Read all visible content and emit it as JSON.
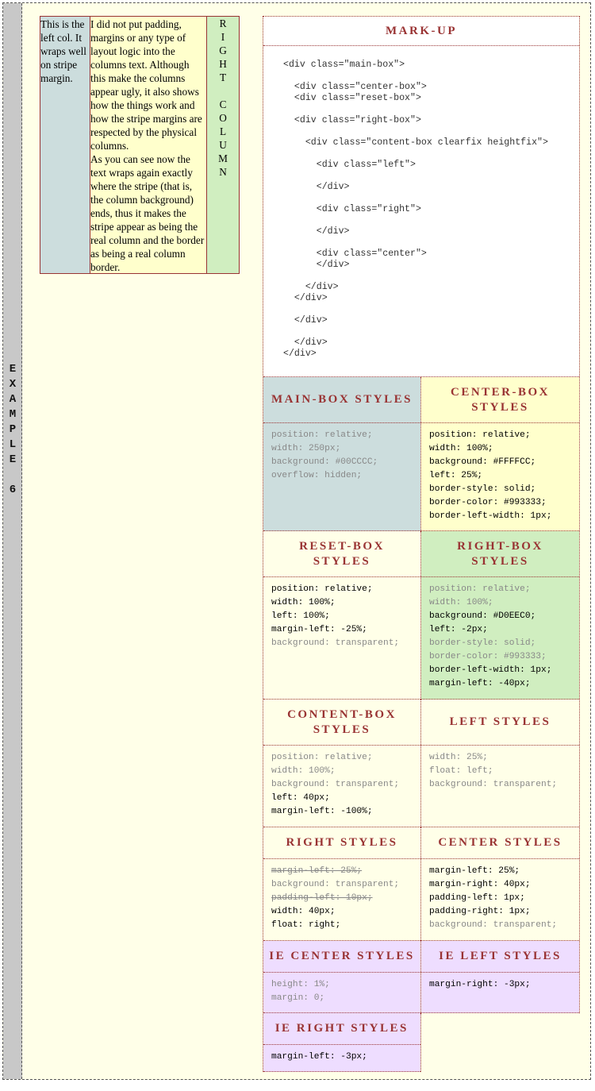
{
  "sidebar": {
    "title": "E\nX\nA\nM\nP\nL\nE\n\n6"
  },
  "demo": {
    "left_text": "This is the left col. It wraps well on stripe margin.",
    "center_text_1": "I did not put padding, margins or any type of layout logic into the columns text. Although this make the columns appear ugly, it also shows how the things work and how the stripe margins are respected by the physical columns.",
    "center_text_2": "As you can see now the text wraps again exactly where the stripe (that is, the column background) ends, thus it makes the stripe appear as being the real column and the border as being a real column border.",
    "right_text": "R\nI\nG\nH\nT\n\nC\nO\nL\nU\nM\nN"
  },
  "markup": {
    "title": "MARK-UP",
    "code": "<div class=\"main-box\">\n\n  <div class=\"center-box\">\n  <div class=\"reset-box\">\n\n  <div class=\"right-box\">\n\n    <div class=\"content-box clearfix heightfix\">\n\n      <div class=\"left\">\n\n      </div>\n\n      <div class=\"right\">\n\n      </div>\n\n      <div class=\"center\">\n      </div>\n\n    </div>\n  </div>\n\n  </div>\n\n  </div>\n</div>"
  },
  "colors": {
    "accent": "#993333",
    "main_box": "#00CCCC",
    "main_box_shown": "#CCDDDD",
    "center_box": "#FFFFCC",
    "right_box": "#D0EEC0",
    "ie": "#EEDDFF",
    "sidebar": "#C8C8C8",
    "page": "#FFFFE8"
  },
  "styles": [
    {
      "left": {
        "title": "MAIN-BOX STYLES",
        "lines": [
          {
            "text": "position: relative;",
            "state": "off"
          },
          {
            "text": "width: 250px;",
            "state": "off"
          },
          {
            "text": "background: #00CCCC;",
            "state": "off"
          },
          {
            "text": "overflow: hidden;",
            "state": "off"
          }
        ]
      },
      "right": {
        "title": "CENTER-BOX STYLES",
        "lines": [
          {
            "text": "position: relative;",
            "state": "on"
          },
          {
            "text": "width: 100%;",
            "state": "on"
          },
          {
            "text": "background: #FFFFCC;",
            "state": "on"
          },
          {
            "text": "left: 25%;",
            "state": "on"
          },
          {
            "text": "border-style: solid;",
            "state": "on"
          },
          {
            "text": "border-color: #993333;",
            "state": "on"
          },
          {
            "text": "border-left-width: 1px;",
            "state": "on"
          }
        ]
      }
    },
    {
      "left": {
        "title": "RESET-BOX STYLES",
        "lines": [
          {
            "text": "position: relative;",
            "state": "on"
          },
          {
            "text": "width: 100%;",
            "state": "on"
          },
          {
            "text": "left: 100%;",
            "state": "on"
          },
          {
            "text": "margin-left: -25%;",
            "state": "on"
          },
          {
            "text": "background: transparent;",
            "state": "off"
          }
        ]
      },
      "right": {
        "title": "RIGHT-BOX STYLES",
        "lines": [
          {
            "text": "position: relative;",
            "state": "off"
          },
          {
            "text": "width: 100%;",
            "state": "off"
          },
          {
            "text": "background: #D0EEC0;",
            "state": "on"
          },
          {
            "text": "left: -2px;",
            "state": "on"
          },
          {
            "text": "border-style: solid;",
            "state": "off"
          },
          {
            "text": "border-color: #993333;",
            "state": "off"
          },
          {
            "text": "border-left-width: 1px;",
            "state": "on"
          },
          {
            "text": "margin-left: -40px;",
            "state": "on"
          }
        ]
      }
    },
    {
      "left": {
        "title": "CONTENT-BOX STYLES",
        "lines": [
          {
            "text": "position: relative;",
            "state": "off"
          },
          {
            "text": "width: 100%;",
            "state": "off"
          },
          {
            "text": "background: transparent;",
            "state": "off"
          },
          {
            "text": "left: 40px;",
            "state": "on"
          },
          {
            "text": "margin-left: -100%;",
            "state": "on"
          }
        ]
      },
      "right": {
        "title": "LEFT STYLES",
        "lines": [
          {
            "text": "width: 25%;",
            "state": "off"
          },
          {
            "text": "float: left;",
            "state": "off"
          },
          {
            "text": "background: transparent;",
            "state": "off"
          }
        ]
      }
    },
    {
      "left": {
        "title": "RIGHT STYLES",
        "lines": [
          {
            "text": "margin-left: 25%;",
            "state": "del"
          },
          {
            "text": "background: transparent;",
            "state": "off"
          },
          {
            "text": "padding-left: 10px;",
            "state": "del"
          },
          {
            "text": "width: 40px;",
            "state": "on"
          },
          {
            "text": "float: right;",
            "state": "on"
          }
        ]
      },
      "right": {
        "title": "CENTER STYLES",
        "lines": [
          {
            "text": "margin-left: 25%;",
            "state": "on"
          },
          {
            "text": "margin-right: 40px;",
            "state": "on"
          },
          {
            "text": "padding-left: 1px;",
            "state": "on"
          },
          {
            "text": "padding-right: 1px;",
            "state": "on"
          },
          {
            "text": "background: transparent;",
            "state": "off"
          }
        ]
      }
    },
    {
      "left": {
        "title": "IE CENTER STYLES",
        "lines": [
          {
            "text": "height: 1%;",
            "state": "off"
          },
          {
            "text": "margin: 0;",
            "state": "off"
          }
        ]
      },
      "right": {
        "title": "IE LEFT STYLES",
        "lines": [
          {
            "text": "margin-right: -3px;",
            "state": "on"
          }
        ]
      }
    },
    {
      "left": {
        "title": "IE RIGHT STYLES",
        "lines": [
          {
            "text": "margin-left: -3px;",
            "state": "on"
          }
        ]
      },
      "right": null
    }
  ]
}
